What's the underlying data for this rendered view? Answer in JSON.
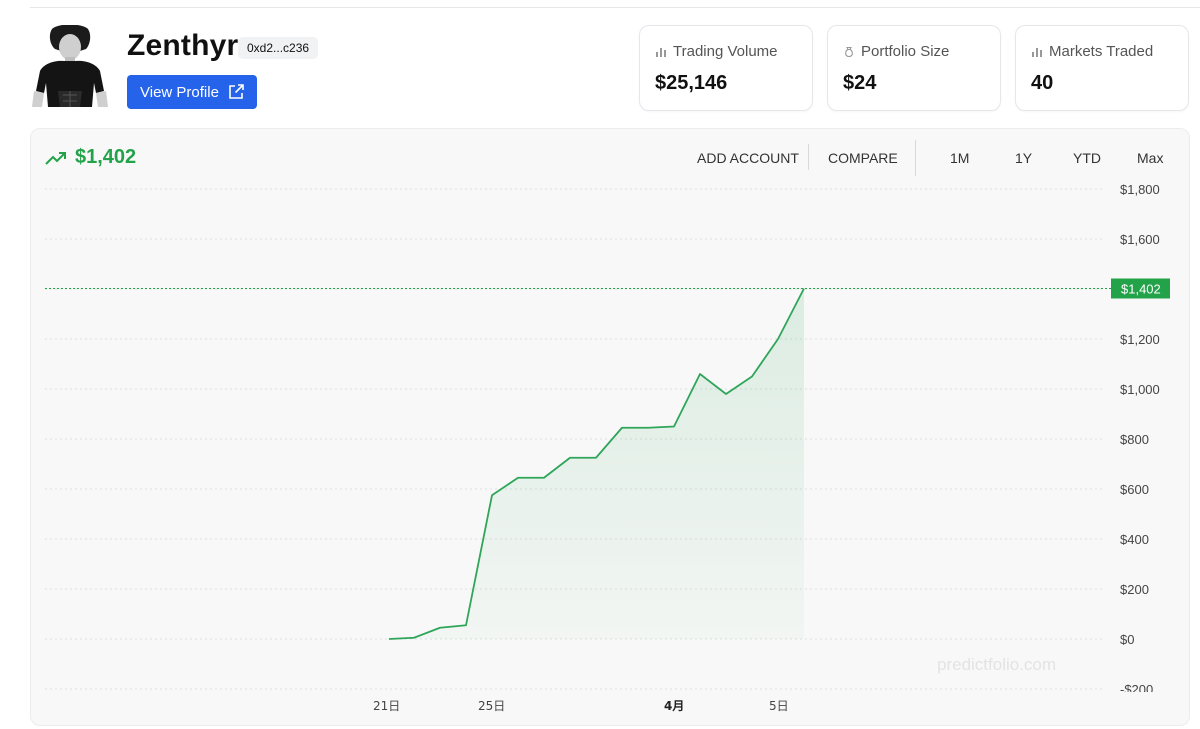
{
  "profile": {
    "name": "Zenthyr",
    "address": "0xd2...c236",
    "view_profile_label": "View Profile"
  },
  "stats": [
    {
      "label": "Trading Volume",
      "value": "$25,146",
      "icon": "bar-chart-icon"
    },
    {
      "label": "Portfolio Size",
      "value": "$24",
      "icon": "money-bag-icon"
    },
    {
      "label": "Markets Traded",
      "value": "40",
      "icon": "bar-chart-icon"
    }
  ],
  "chart_header": {
    "pnl_value": "$1,402",
    "trend_icon": "trending-up-icon",
    "add_account": "ADD ACCOUNT",
    "compare": "COMPARE",
    "ranges": [
      "1M",
      "1Y",
      "YTD",
      "Max"
    ]
  },
  "watermark": "predictfolio.com",
  "colors": {
    "accent": "#2563eb",
    "positive": "#22a34a",
    "line": "#2fa55a"
  },
  "chart_data": {
    "type": "area",
    "current_label": "$1,402",
    "y_ticks": [
      -200,
      0,
      200,
      400,
      600,
      800,
      1000,
      1200,
      1400,
      1600,
      1800
    ],
    "y_tick_labels": [
      "-$200",
      "$0",
      "$200",
      "$400",
      "$600",
      "$800",
      "$1,000",
      "$1,200",
      "$1,600",
      "$1,800"
    ],
    "ylim": [
      -200,
      1800
    ],
    "x_tick_labels": [
      "21日",
      "25日",
      "4月",
      "5日"
    ],
    "series": [
      {
        "values": [
          0,
          5,
          45,
          55,
          575,
          645,
          645,
          725,
          725,
          845,
          845,
          850,
          1060,
          980,
          1050,
          1200,
          1402
        ]
      }
    ],
    "grid": true
  }
}
